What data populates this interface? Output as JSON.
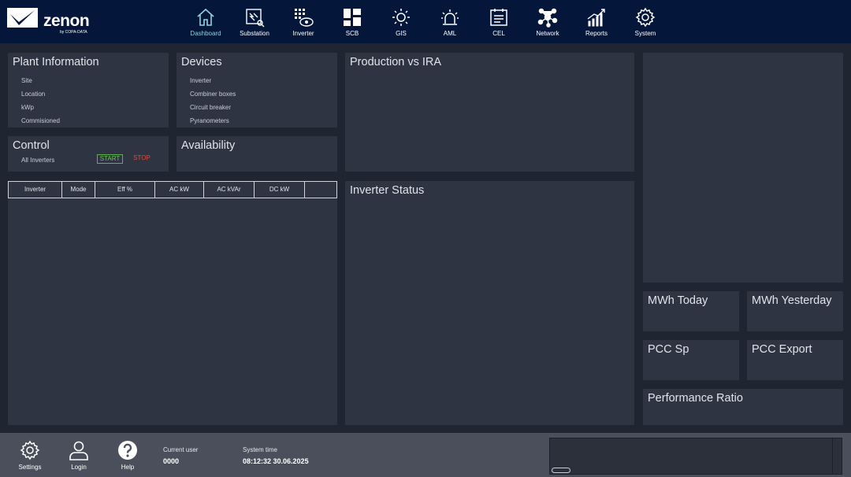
{
  "brand": {
    "name": "zenon",
    "byline": "by COPA-DATA"
  },
  "nav": {
    "items": [
      {
        "label": "Dashboard",
        "icon": "home-icon"
      },
      {
        "label": "Substation",
        "icon": "substation-icon"
      },
      {
        "label": "Inverter",
        "icon": "inverter-icon"
      },
      {
        "label": "SCB",
        "icon": "scb-icon"
      },
      {
        "label": "GIS",
        "icon": "sun-icon"
      },
      {
        "label": "AML",
        "icon": "alarm-icon"
      },
      {
        "label": "CEL",
        "icon": "event-list-icon"
      },
      {
        "label": "Network",
        "icon": "network-icon"
      },
      {
        "label": "Reports",
        "icon": "reports-icon"
      },
      {
        "label": "System",
        "icon": "gear-icon"
      }
    ],
    "active": "Dashboard",
    "active_color": "#8fd3dd"
  },
  "plant_info": {
    "title": "Plant Information",
    "rows": [
      "Site",
      "Location",
      "kWp",
      "Commisioned"
    ]
  },
  "devices": {
    "title": "Devices",
    "rows": [
      "Inverter",
      "Combiner boxes",
      "Circuit breaker",
      "Pyranometers"
    ]
  },
  "control": {
    "title": "Control",
    "target_label": "All Inverters",
    "start_label": "START",
    "stop_label": "STOP",
    "start_color": "#6cc255",
    "stop_color": "#e0483e"
  },
  "availability": {
    "title": "Availability"
  },
  "production": {
    "title": "Production vs IRA"
  },
  "inverter_status": {
    "title": "Inverter Status"
  },
  "inverter_table": {
    "columns": [
      "Inverter",
      "Mode",
      "Eff %",
      "AC kW",
      "AC kVAr",
      "DC kW",
      ""
    ]
  },
  "kpis": {
    "mwh_today": "MWh Today",
    "mwh_yesterday": "MWh Yesterday",
    "pcc_sp": "PCC Sp",
    "pcc_export": "PCC Export",
    "performance_ratio": "Performance Ratio"
  },
  "footer": {
    "settings_label": "Settings",
    "login_label": "Login",
    "help_label": "Help",
    "current_user_caption": "Current user",
    "current_user_value": "0000",
    "system_time_caption": "System time",
    "system_time_value": "08:12:32 30.06.2025"
  }
}
